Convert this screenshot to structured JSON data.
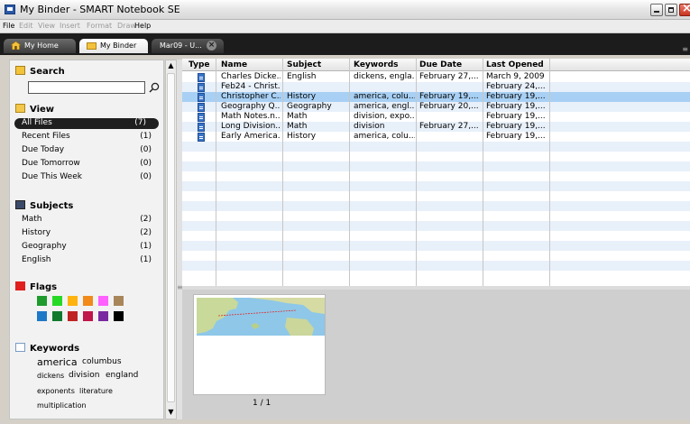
{
  "window": {
    "title": "My Binder - SMART Notebook SE"
  },
  "menu": [
    {
      "label": "File",
      "enabled": true
    },
    {
      "label": "Edit",
      "enabled": false
    },
    {
      "label": "View",
      "enabled": false
    },
    {
      "label": "Insert",
      "enabled": false
    },
    {
      "label": "Format",
      "enabled": false
    },
    {
      "label": "Draw",
      "enabled": false
    },
    {
      "label": "Help",
      "enabled": true
    }
  ],
  "tabs": {
    "home": "My Home",
    "binder": "My Binder",
    "doc": "Mar09 - U..."
  },
  "sidebar": {
    "search": {
      "title": "Search",
      "value": ""
    },
    "view": {
      "title": "View",
      "items": [
        {
          "label": "All Files",
          "count": "(7)"
        },
        {
          "label": "Recent Files",
          "count": "(1)"
        },
        {
          "label": "Due Today",
          "count": "(0)"
        },
        {
          "label": "Due Tomorrow",
          "count": "(0)"
        },
        {
          "label": "Due This Week",
          "count": "(0)"
        }
      ]
    },
    "subjects": {
      "title": "Subjects",
      "items": [
        {
          "label": "Math",
          "count": "(2)"
        },
        {
          "label": "History",
          "count": "(2)"
        },
        {
          "label": "Geography",
          "count": "(1)"
        },
        {
          "label": "English",
          "count": "(1)"
        }
      ]
    },
    "flags": {
      "title": "Flags",
      "colors_row1": [
        "#1e9b2c",
        "#27d927",
        "#ffb30f",
        "#f18a1a",
        "#ff60ff",
        "#a8865a"
      ],
      "colors_row2": [
        "#1e78c8",
        "#117a2f",
        "#c02222",
        "#c0164a",
        "#7a2aa0",
        "#000000"
      ]
    },
    "keywords": {
      "title": "Keywords",
      "words": [
        "america",
        "columbus",
        "dickens",
        "division",
        "england",
        "exponents",
        "literature",
        "multiplication"
      ]
    }
  },
  "filelist": {
    "columns": [
      "Type",
      "Name",
      "Subject",
      "Keywords",
      "Due Date",
      "Last Opened"
    ],
    "rows": [
      {
        "name": "Charles Dicke...",
        "subject": "English",
        "keywords": "dickens, engla...",
        "due": "February 27,...",
        "opened": "March 9, 2009"
      },
      {
        "name": "Feb24 - Christ...",
        "subject": "",
        "keywords": "",
        "due": "",
        "opened": "February 24,..."
      },
      {
        "name": "Christopher C...",
        "subject": "History",
        "keywords": "america, colu...",
        "due": "February 19,...",
        "opened": "February 19,..."
      },
      {
        "name": "Geography Q...",
        "subject": "Geography",
        "keywords": "america, engl...",
        "due": "February 20,...",
        "opened": "February 19,..."
      },
      {
        "name": "Math Notes.n...",
        "subject": "Math",
        "keywords": "division, expo...",
        "due": "",
        "opened": "February 19,..."
      },
      {
        "name": "Long Division...",
        "subject": "Math",
        "keywords": "division",
        "due": "February 27,...",
        "opened": "February 19,..."
      },
      {
        "name": "Early America...",
        "subject": "History",
        "keywords": "america, colu...",
        "due": "",
        "opened": "February 19,..."
      }
    ],
    "selected_row": 2
  },
  "preview": {
    "page_label": "1 / 1"
  }
}
